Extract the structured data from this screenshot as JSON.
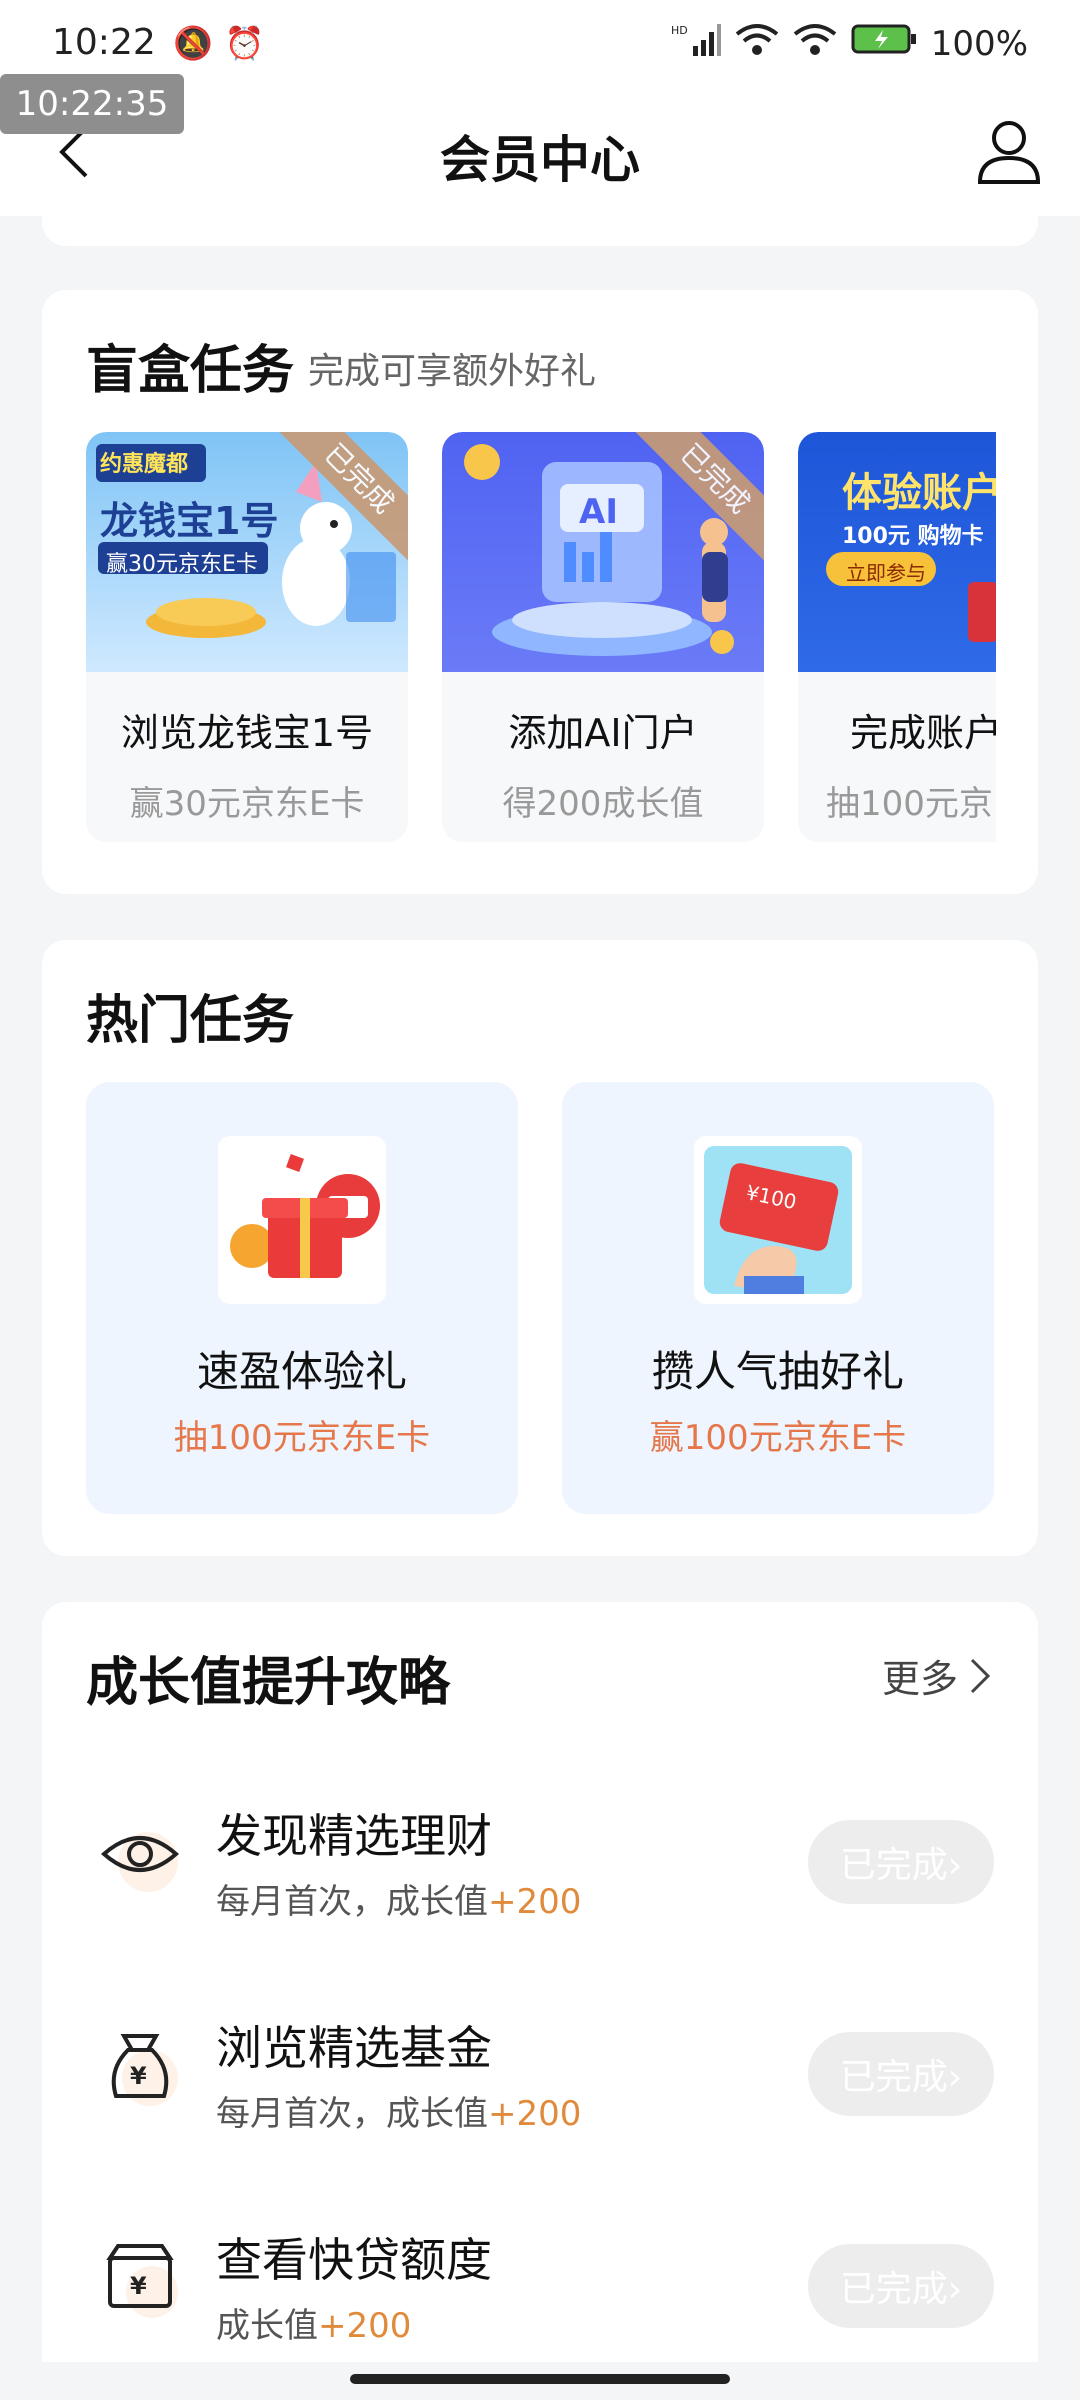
{
  "status_bar": {
    "time": "10:22",
    "battery": "100%",
    "timestamp_overlay": "10:22:35"
  },
  "header": {
    "title": "会员中心",
    "back_icon": "chevron-left-icon",
    "user_icon": "user-icon"
  },
  "blind_box": {
    "title": "盲盒任务",
    "subtitle": "完成可享额外好礼",
    "items": [
      {
        "title": "浏览龙钱宝1号",
        "reward": "赢30元京东E卡",
        "badge": "已完成",
        "banner_line1": "约惠魔都",
        "banner_line2": "龙钱宝1号",
        "banner_line3": "赢30元京东E卡"
      },
      {
        "title": "添加AI门户",
        "reward": "得200成长值",
        "badge": "已完成",
        "banner_line1": "AI"
      },
      {
        "title": "完成账户",
        "reward": "抽100元京",
        "banner_line1": "体验账户",
        "banner_line2": "100元 购物卡",
        "banner_line3": "立即参与"
      }
    ]
  },
  "hot_tasks": {
    "title": "热门任务",
    "items": [
      {
        "title": "速盈体验礼",
        "reward": "抽100元京东E卡"
      },
      {
        "title": "攒人气抽好礼",
        "reward": "赢100元京东E卡"
      }
    ]
  },
  "growth": {
    "title": "成长值提升攻略",
    "more": "更多",
    "items": [
      {
        "title": "发现精选理财",
        "desc": "每月首次，成长值",
        "plus": "+200",
        "button": "已完成›",
        "icon": "eye-icon"
      },
      {
        "title": "浏览精选基金",
        "desc": "每月首次，成长值",
        "plus": "+200",
        "button": "已完成›",
        "icon": "money-bag-icon"
      },
      {
        "title": "查看快贷额度",
        "desc": "成长值",
        "plus": "+200",
        "button": "已完成›",
        "icon": "yuan-box-icon"
      }
    ]
  },
  "colors": {
    "accent_orange": "#e5774b",
    "plus_orange": "#e08a3c",
    "hot_card_bg": "#eef5fe",
    "badge_brown": "#c79b77"
  }
}
